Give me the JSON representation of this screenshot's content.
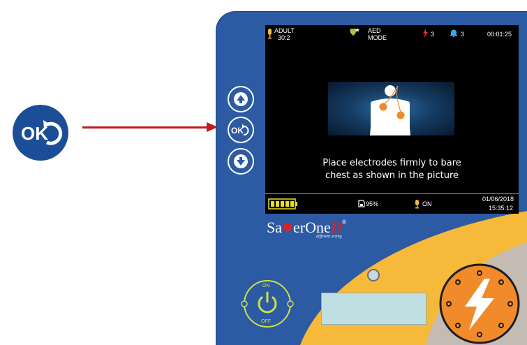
{
  "callout": {
    "icon": "ok-return-icon",
    "arrow_color": "#c41a1a"
  },
  "device": {
    "colors": {
      "panel": "#2c5ba3",
      "yellow": "#f6b93a",
      "grey": "#c4bbb2",
      "shock": "#f08a2a",
      "power_ring": "#cde04a"
    },
    "nav_buttons": [
      {
        "name": "up-arrow-button",
        "icon": "arrow-up-icon"
      },
      {
        "name": "ok-button",
        "icon": "ok-return-icon"
      },
      {
        "name": "down-arrow-button",
        "icon": "arrow-down-icon"
      }
    ],
    "screen": {
      "status": {
        "mode_line1": "ADULT",
        "mode_line2": "30:2",
        "aed_line1": "AED",
        "aed_line2": "MODE",
        "alarm_count": "3",
        "bell_count": "3",
        "timer": "00:01:25"
      },
      "instruction_line1": "Place electrodes firmly to bare",
      "instruction_line2": "chest as shown in the picture",
      "bottom": {
        "battery_icon": "battery-full-icon",
        "memory": "95%",
        "voice": "ON",
        "date": "01/06/2018",
        "time": "15:35:12"
      }
    },
    "brand": {
      "pre": "Sa",
      "mid": "er",
      "one": "One",
      "d": "D",
      "tagline": "different acting"
    },
    "power": {
      "on_label": "ON",
      "off_label": "OFF"
    },
    "shock_button": {
      "icon": "lightning-bolt-icon"
    }
  }
}
